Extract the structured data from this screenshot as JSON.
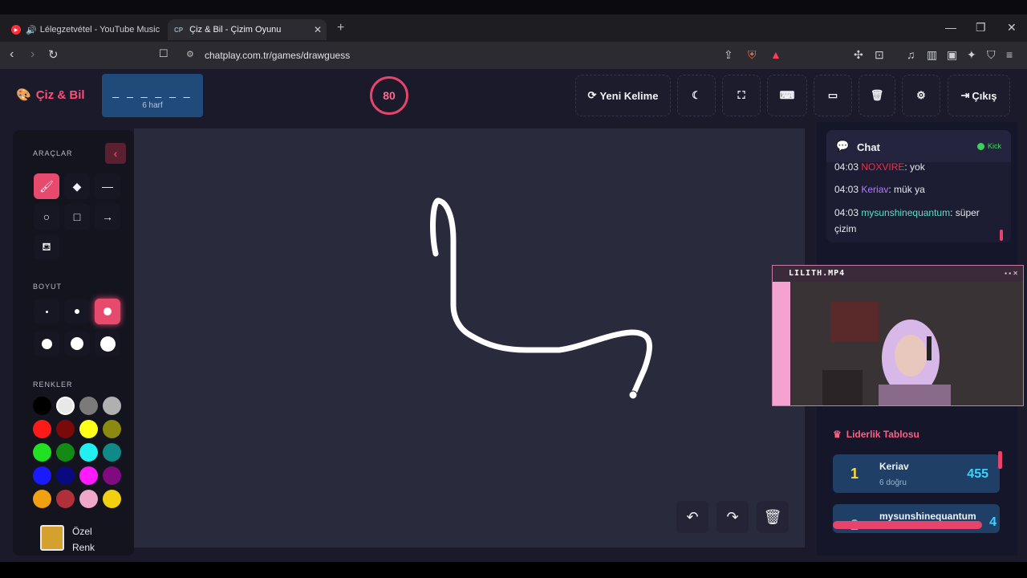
{
  "browser": {
    "tabs": [
      {
        "label": "Lélegzetvétel - YouTube Music",
        "active": false
      },
      {
        "label": "Çiz & Bil - Çizim Oyunu",
        "active": true,
        "badge": "CP"
      }
    ],
    "url": "chatplay.com.tr/games/drawguess"
  },
  "app": {
    "logo": "Çiz & Bil",
    "word_blanks": "_ _ _ _ _ _",
    "word_hint": "6 harf",
    "timer": "80",
    "toolbar": {
      "new_word": "Yeni Kelime",
      "exit": "Çıkış"
    }
  },
  "tools_panel": {
    "tools_title": "ARAÇLAR",
    "size_title": "BOYUT",
    "colors_title": "RENKLER",
    "custom_color_label": "Özel Renk",
    "colors": [
      "#000000",
      "#e8e8e8",
      "#7a7a7a",
      "#b0b0b0",
      "#ff1a1a",
      "#7a0a0a",
      "#ffff1a",
      "#8a8a10",
      "#22e022",
      "#138a13",
      "#22f0f0",
      "#0f8a86",
      "#1a1aff",
      "#0a0a80",
      "#ff1aff",
      "#800a80",
      "#f0a010",
      "#b0303a",
      "#f0a8c8",
      "#f0d010"
    ]
  },
  "chat": {
    "title": "Chat",
    "status": "Kick",
    "messages": [
      {
        "time": "04:03",
        "user": "NOXVIRE",
        "text": ": yok",
        "color": "#e8334d"
      },
      {
        "time": "04:03",
        "user": "Keriav",
        "text": ": mük ya",
        "color": "#b57cff"
      },
      {
        "time": "04:03",
        "user": "mysunshinequantum",
        "text": ": süper çizim",
        "color": "#5ce0c8"
      }
    ]
  },
  "webcam": {
    "title": "LILITH.MP4"
  },
  "leaderboard": {
    "title": "Liderlik Tablosu",
    "rows": [
      {
        "rank": "1",
        "name": "Keriav",
        "sub": "6 doğru",
        "score": "455"
      },
      {
        "rank": "2",
        "name": "mysunshinequantum",
        "sub": "",
        "score": "4"
      }
    ]
  },
  "colors": {
    "accent": "#e84a6e",
    "canvas_bg": "#2a2a3d",
    "stroke": "#ffffff"
  }
}
